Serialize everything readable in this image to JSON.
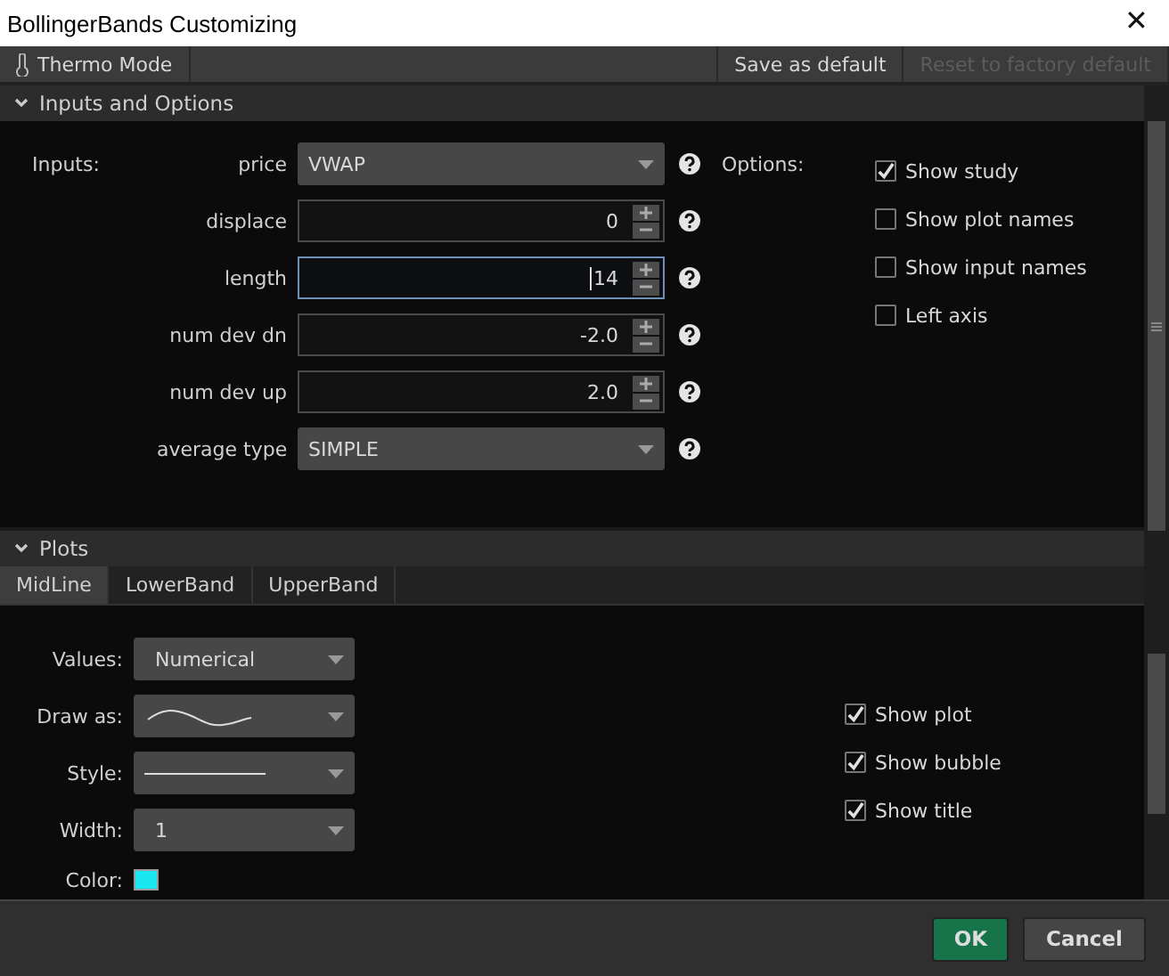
{
  "window": {
    "title": "BollingerBands Customizing",
    "close_glyph": "✕"
  },
  "toolbar": {
    "thermo_mode": "Thermo Mode",
    "save_default": {
      "label": "Save as default",
      "disabled": false
    },
    "reset_default": {
      "label": "Reset to factory default",
      "disabled": true
    }
  },
  "inputs_section": {
    "title": "Inputs and Options",
    "expanded": true,
    "inputs_label": "Inputs:",
    "options_label": "Options:"
  },
  "inputs": [
    {
      "label": "price",
      "kind": "dropdown",
      "value": "VWAP"
    },
    {
      "label": "displace",
      "kind": "spinner",
      "value": "0",
      "focused": false
    },
    {
      "label": "length",
      "kind": "spinner",
      "value": "14",
      "focused": true
    },
    {
      "label": "num dev dn",
      "kind": "spinner",
      "value": "-2.0",
      "focused": false
    },
    {
      "label": "num dev up",
      "kind": "spinner",
      "value": "2.0",
      "focused": false
    },
    {
      "label": "average type",
      "kind": "dropdown",
      "value": "SIMPLE"
    }
  ],
  "options": [
    {
      "label": "Show study",
      "checked": true
    },
    {
      "label": "Show plot names",
      "checked": false
    },
    {
      "label": "Show input names",
      "checked": false
    },
    {
      "label": "Left axis",
      "checked": false
    }
  ],
  "plots_section": {
    "title": "Plots",
    "expanded": true
  },
  "plot_tabs": [
    {
      "label": "MidLine",
      "selected": true
    },
    {
      "label": "LowerBand",
      "selected": false
    },
    {
      "label": "UpperBand",
      "selected": false
    }
  ],
  "plot_settings": [
    {
      "label": "Values:",
      "kind": "text",
      "value": "Numerical"
    },
    {
      "label": "Draw as:",
      "kind": "curve"
    },
    {
      "label": "Style:",
      "kind": "solid-line"
    },
    {
      "label": "Width:",
      "kind": "text",
      "value": "1"
    }
  ],
  "plot_color": {
    "label": "Color:",
    "color": "#19e6ee"
  },
  "plot_options": [
    {
      "label": "Show plot",
      "checked": true
    },
    {
      "label": "Show bubble",
      "checked": true
    },
    {
      "label": "Show title",
      "checked": true
    }
  ],
  "buttons": [
    {
      "label": "OK",
      "kind": "primary"
    },
    {
      "label": "Cancel",
      "kind": "secondary"
    }
  ]
}
